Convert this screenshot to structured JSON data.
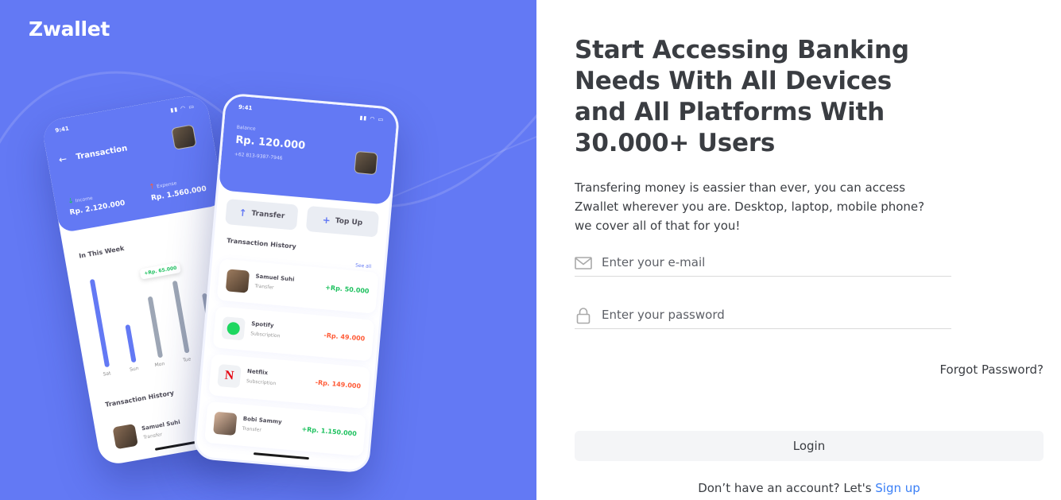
{
  "brand": {
    "name": "Zwallet"
  },
  "hero": {
    "back_phone": {
      "time": "9:41",
      "title": "Transaction",
      "income_label": "Income",
      "income_value": "Rp. 2.120.000",
      "expense_label": "Expense",
      "expense_value": "Rp. 1.560.000",
      "week_title": "In This Week",
      "tooltip": "+Rp. 65.000",
      "days": [
        "Sat",
        "Sun",
        "Mon",
        "Tue"
      ],
      "history_title": "Transaction History",
      "row": {
        "name": "Samuel Suhi",
        "sub": "Transfer"
      }
    },
    "front_phone": {
      "time": "9:41",
      "balance_label": "Balance",
      "balance": "Rp. 120.000",
      "phone": "+62 813-9387-7946",
      "transfer_label": "Transfer",
      "topup_label": "Top Up",
      "history_title": "Transaction History",
      "see_all": "See all",
      "transactions": [
        {
          "name": "Samuel Suhi",
          "sub": "Transfer",
          "amount": "+Rp. 50.000",
          "icon": "avatar"
        },
        {
          "name": "Spotify",
          "sub": "Subscription",
          "amount": "-Rp. 49.000",
          "icon": "spotify-icon"
        },
        {
          "name": "Netflix",
          "sub": "Subscription",
          "amount": "-Rp. 149.000",
          "icon": "netflix-icon"
        },
        {
          "name": "Bobi Sammy",
          "sub": "Transfer",
          "amount": "+Rp. 1.150.000",
          "icon": "avatar"
        }
      ]
    }
  },
  "form": {
    "headline": "Start Accessing Banking Needs With All Devices and All Platforms With 30.000+ Users",
    "description": "Transfering money is eassier than ever, you can access Zwallet wherever you are. Desktop, laptop, mobile phone? we cover all of that for you!",
    "email": {
      "value": "",
      "placeholder": "Enter your e-mail",
      "icon": "mail-icon"
    },
    "password": {
      "value": "",
      "placeholder": "Enter your password",
      "icon": "lock-icon"
    },
    "forgot": "Forgot Password?",
    "login_label": "Login",
    "signup_prompt": "Don’t have an account? Let's ",
    "signup_link": "Sign up"
  },
  "colors": {
    "primary": "#6379f4",
    "link": "#3a7ff6",
    "positive": "#1ec15f",
    "negative": "#ff5b37"
  }
}
